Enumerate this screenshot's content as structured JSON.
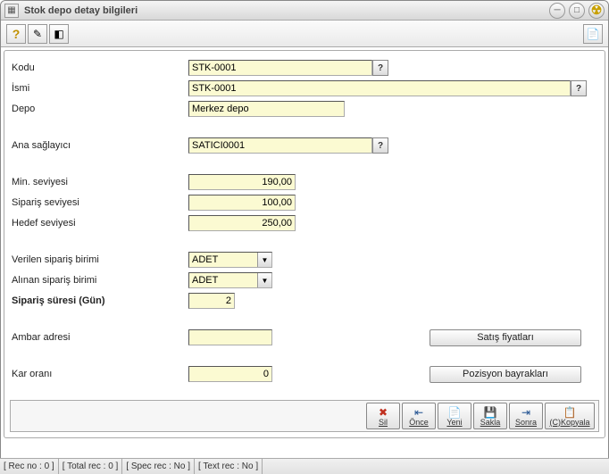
{
  "window": {
    "title": "Stok depo detay bilgileri"
  },
  "labels": {
    "code": "Kodu",
    "name": "İsmi",
    "depot": "Depo",
    "main_supplier": "Ana sağlayıcı",
    "min_level": "Min. seviyesi",
    "order_level": "Sipariş seviyesi",
    "target_level": "Hedef seviyesi",
    "order_unit_out": "Verilen sipariş birimi",
    "order_unit_in": "Alınan sipariş birimi",
    "order_duration": "Sipariş süresi (Gün)",
    "warehouse_addr": "Ambar adresi",
    "profit_rate": "Kar oranı"
  },
  "values": {
    "code": "STK-0001",
    "name": "STK-0001",
    "depot": "Merkez depo",
    "main_supplier": "SATICI0001",
    "min_level": "190,00",
    "order_level": "100,00",
    "target_level": "250,00",
    "order_unit_out": "ADET",
    "order_unit_in": "ADET",
    "order_duration": "2",
    "warehouse_addr": "",
    "profit_rate": "0"
  },
  "buttons": {
    "sales_prices": "Satış fiyatları",
    "position_flags": "Pozisyon bayrakları"
  },
  "commands": {
    "delete": "Sil",
    "prev": "Önce",
    "new": "Yeni",
    "save": "Sakla",
    "next": "Sonra",
    "copy": "(C)Kopyala"
  },
  "status": {
    "rec_no": "[ Rec no : 0 ]",
    "total_rec": "[ Total rec : 0 ]",
    "spec_rec": "[ Spec rec : No ]",
    "text_rec": "[ Text rec : No ]"
  },
  "glyphs": {
    "question": "?",
    "dropdown": "▼"
  }
}
